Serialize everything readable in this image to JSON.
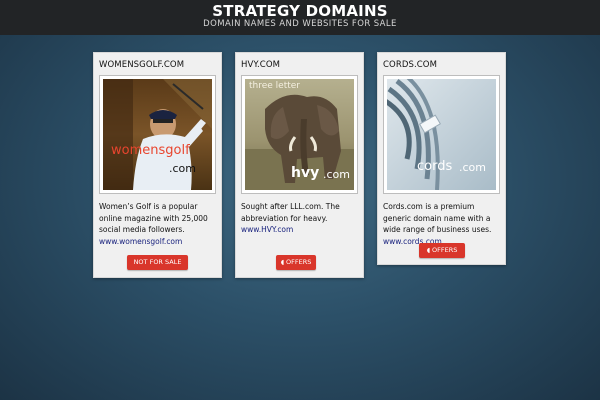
{
  "header": {
    "title": "STRATEGY DOMAINS",
    "tagline": "DOMAIN NAMES AND WEBSITES FOR SALE"
  },
  "colors": {
    "header_bg": "#222426",
    "background": "#2c5068",
    "button": "#d9362b",
    "link": "#1a237e"
  },
  "cards": [
    {
      "name": "WOMENSGOLF.COM",
      "image_text_1": "womensgolf",
      "image_text_2": ".com",
      "description": "Women’s Golf is a popular online magazine with 25,000 social media followers.",
      "link": "www.womensgolf.com",
      "button": {
        "label": "NOT FOR SALE",
        "icon": ""
      }
    },
    {
      "name": "HVY.COM",
      "image_text_1": "three letter",
      "image_text_2": "hvy",
      "image_text_3": ".com",
      "description": "Sought after LLL.com.  The abbreviation for heavy.",
      "link": "www.HVY.com",
      "button": {
        "label": "OFFERS",
        "icon": "tag-icon"
      }
    },
    {
      "name": "CORDS.COM",
      "image_text_1": "cords",
      "image_text_2": ".com",
      "description": "Cords.com is a premium generic domain name with a wide range of business uses.",
      "link": "www.cords.com",
      "button": {
        "label": "OFFERS",
        "icon": "tag-icon"
      }
    }
  ]
}
